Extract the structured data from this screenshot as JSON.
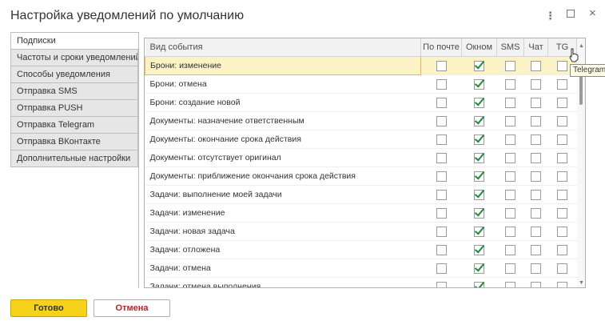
{
  "window": {
    "title": "Настройка уведомлений по умолчанию",
    "more_icon": "⋮",
    "maximize_icon": "",
    "close_icon": "×"
  },
  "tabs": [
    {
      "label": "Подписки",
      "active": true
    },
    {
      "label": "Частоты и сроки уведомлений",
      "active": false
    },
    {
      "label": "Способы уведомления",
      "active": false
    },
    {
      "label": "Отправка SMS",
      "active": false
    },
    {
      "label": "Отправка PUSH",
      "active": false
    },
    {
      "label": "Отправка Telegram",
      "active": false
    },
    {
      "label": "Отправка ВКонтакте",
      "active": false
    },
    {
      "label": "Дополнительные настройки",
      "active": false
    }
  ],
  "grid": {
    "columns": [
      "Вид события",
      "По почте",
      "Окном",
      "SMS",
      "Чат",
      "TG"
    ],
    "rows": [
      {
        "event": "Брони: изменение",
        "checks": [
          false,
          true,
          false,
          false,
          false
        ],
        "selected": true
      },
      {
        "event": "Брони: отмена",
        "checks": [
          false,
          true,
          false,
          false,
          false
        ]
      },
      {
        "event": "Брони: создание новой",
        "checks": [
          false,
          true,
          false,
          false,
          false
        ]
      },
      {
        "event": "Документы: назначение ответственным",
        "checks": [
          false,
          true,
          false,
          false,
          false
        ]
      },
      {
        "event": "Документы: окончание срока действия",
        "checks": [
          false,
          true,
          false,
          false,
          false
        ]
      },
      {
        "event": "Документы: отсутствует оригинал",
        "checks": [
          false,
          true,
          false,
          false,
          false
        ]
      },
      {
        "event": "Документы: приближение окончания срока действия",
        "checks": [
          false,
          true,
          false,
          false,
          false
        ]
      },
      {
        "event": "Задачи: выполнение моей задачи",
        "checks": [
          false,
          true,
          false,
          false,
          false
        ]
      },
      {
        "event": "Задачи: изменение",
        "checks": [
          false,
          true,
          false,
          false,
          false
        ]
      },
      {
        "event": "Задачи: новая задача",
        "checks": [
          false,
          true,
          false,
          false,
          false
        ]
      },
      {
        "event": "Задачи: отложена",
        "checks": [
          false,
          true,
          false,
          false,
          false
        ]
      },
      {
        "event": "Задачи: отмена",
        "checks": [
          false,
          true,
          false,
          false,
          false
        ]
      },
      {
        "event": "Задачи: отмена выполнения",
        "checks": [
          false,
          true,
          false,
          false,
          false
        ]
      }
    ]
  },
  "tooltip": "Telegram",
  "buttons": {
    "ok": "Готово",
    "cancel": "Отмена"
  },
  "colors": {
    "accent_button": "#f7d21b",
    "check": "#1a8c3a",
    "cancel_text": "#c41d1d",
    "selected_row": "#fbf2c5"
  }
}
